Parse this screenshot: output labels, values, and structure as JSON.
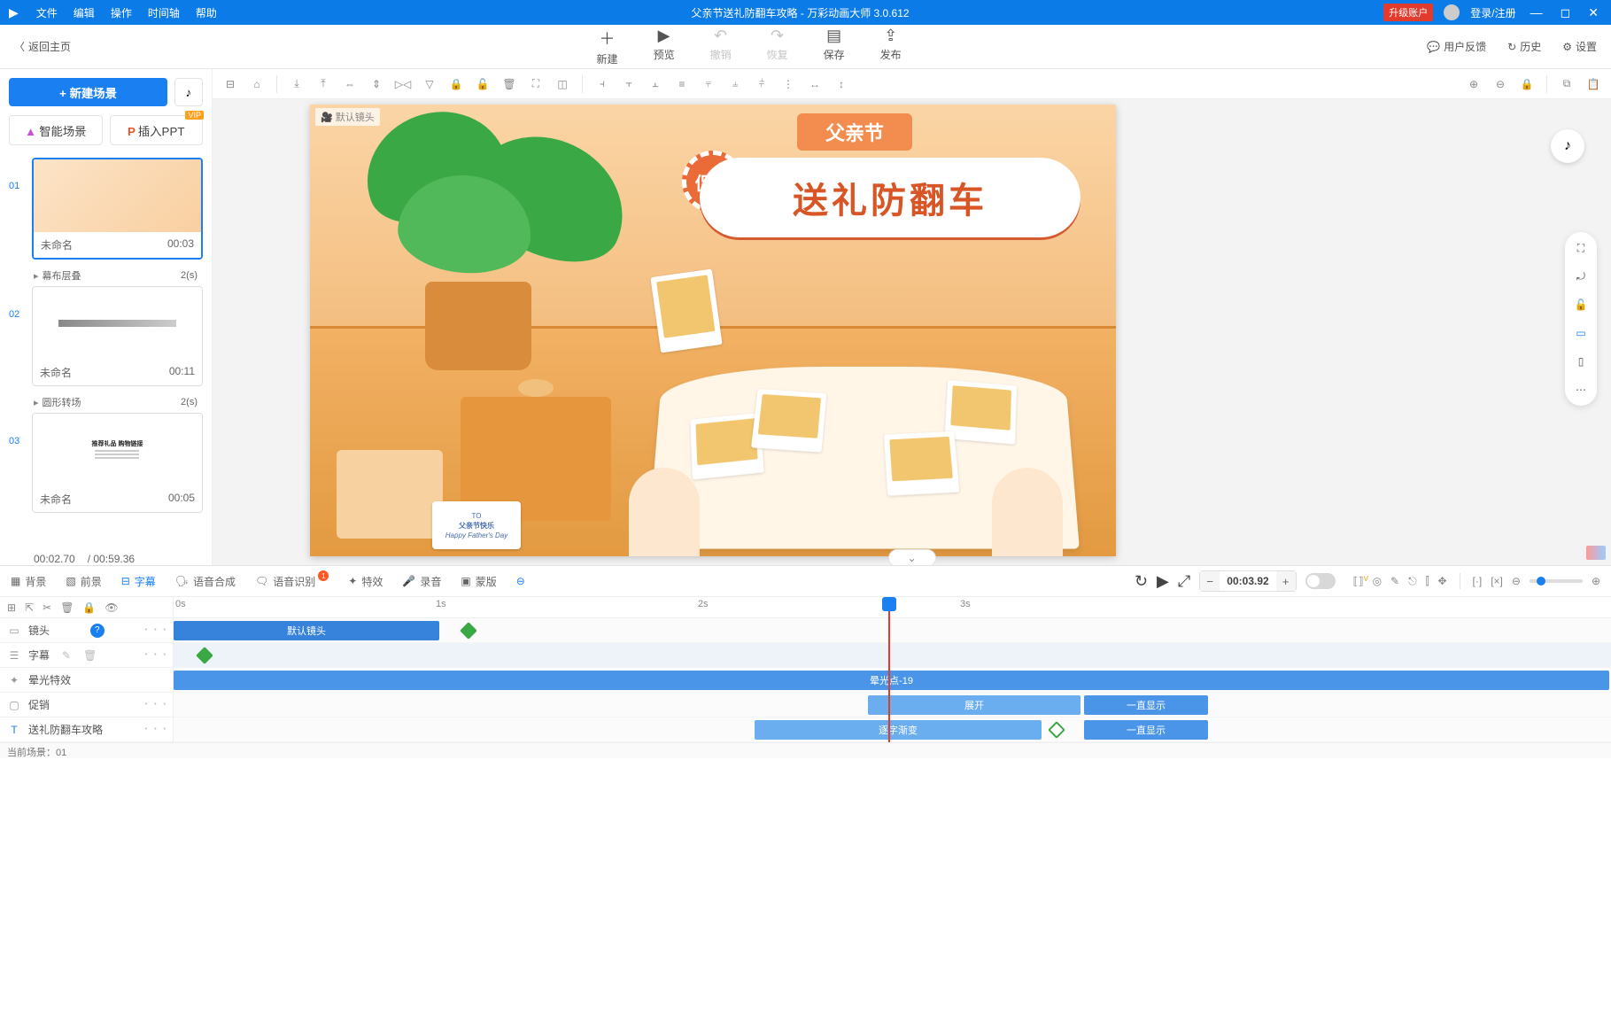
{
  "app": {
    "title": "父亲节送礼防翻车攻略 - 万彩动画大师 3.0.612",
    "upgrade": "升级账户",
    "login": "登录/注册"
  },
  "menu": {
    "file": "文件",
    "edit": "编辑",
    "operate": "操作",
    "timeline": "时间轴",
    "help": "帮助"
  },
  "toolbar": {
    "back": "返回主页",
    "new": "新建",
    "preview": "预览",
    "undo": "撤销",
    "redo": "恢复",
    "save": "保存",
    "publish": "发布",
    "feedback": "用户反馈",
    "history": "历史",
    "settings": "设置"
  },
  "sidebar": {
    "new_scene": "+  新建场景",
    "smart_scene": "智能场景",
    "insert_ppt": "插入PPT",
    "vip": "VIP",
    "scenes": [
      {
        "num": "01",
        "name": "未命名",
        "dur": "00:03",
        "trans": "幕布层叠",
        "trans_dur": "2(s)"
      },
      {
        "num": "02",
        "name": "未命名",
        "dur": "00:11",
        "trans": "圆形转场",
        "trans_dur": "2(s)"
      },
      {
        "num": "03",
        "name": "未命名",
        "dur": "00:05"
      }
    ],
    "cur_time": "00:02.70",
    "total_time": "/ 00:59.36"
  },
  "canvas": {
    "camera_label": "默认镜头",
    "banner_text": "送礼防翻车",
    "tag_text": "父亲节",
    "promo_text": "促销",
    "note_to": "TO",
    "note_main": "父亲节快乐",
    "note_sub": "Happy Father's Day"
  },
  "bottom": {
    "tabs": {
      "bg": "背景",
      "fg": "前景",
      "subtitle": "字幕",
      "tts": "语音合成",
      "asr": "语音识别",
      "fx": "特效",
      "rec": "录音",
      "mask": "蒙版"
    },
    "time_display": "00:03.92",
    "ruler": [
      "0s",
      "1s",
      "2s",
      "3s"
    ],
    "rows": {
      "camera": "镜头",
      "subtitle": "字幕",
      "light_fx": "晕光特效",
      "promo": "促销",
      "guide": "送礼防翻车攻略"
    },
    "clips": {
      "default_camera": "默认镜头",
      "light_item": "晕光点-19",
      "expand": "展开",
      "always_show": "一直显示",
      "char_fade": "逐字渐变"
    },
    "status": "当前场景：01"
  }
}
